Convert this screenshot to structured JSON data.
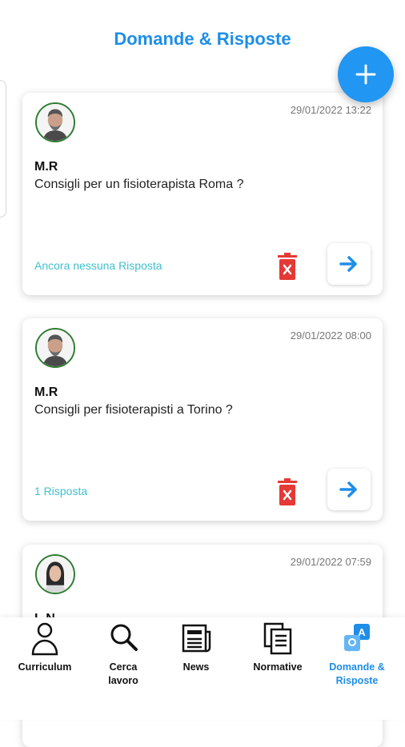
{
  "header": {
    "title": "Domande & Risposte"
  },
  "colors": {
    "accent": "#1e8ee8",
    "fab": "#2196f3",
    "answers": "#3fc0ce",
    "delete": "#e53935",
    "avatar_border": "#2e7d32"
  },
  "questions": [
    {
      "date": "29/01/2022 13:22",
      "author": "M.R",
      "question": "Consigli per un fisioterapista Roma ?",
      "answers": "Ancora nessuna Risposta",
      "avatar": "man-avatar"
    },
    {
      "date": "29/01/2022 08:00",
      "author": "M.R",
      "question": "Consigli per fisioterapisti a Torino ?",
      "answers": "1 Risposta",
      "avatar": "man-avatar"
    },
    {
      "date": "29/01/2022 07:59",
      "author": "L.N",
      "avatar": "woman-avatar"
    }
  ],
  "nav": {
    "items": [
      {
        "label": "Curriculum",
        "icon": "person-icon"
      },
      {
        "label": "Cerca\nlavoro",
        "icon": "search-icon"
      },
      {
        "label": "News",
        "icon": "news-icon"
      },
      {
        "label": "Normative",
        "icon": "documents-icon"
      },
      {
        "label": "Domande &\nRisposte",
        "icon": "qa-icon",
        "active": true
      }
    ]
  }
}
